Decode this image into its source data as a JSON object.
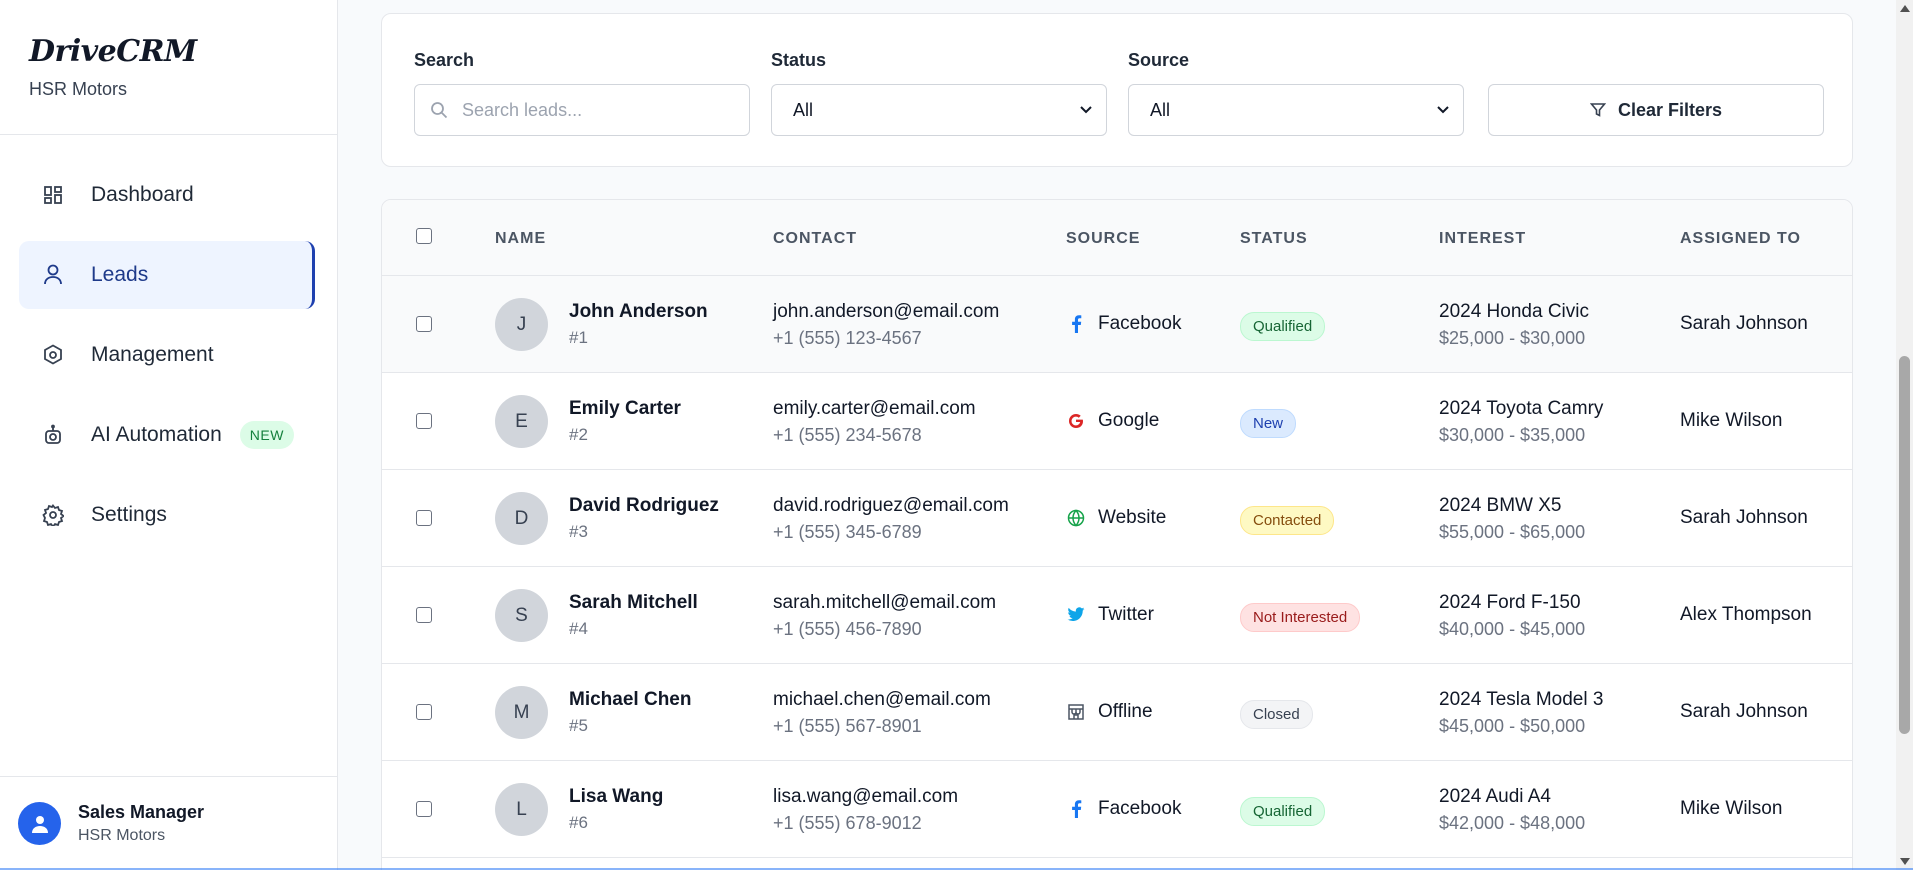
{
  "sidebar": {
    "brand": "DriveCRM",
    "subtitle": "HSR Motors",
    "items": [
      {
        "label": "Dashboard",
        "icon": "dashboard-icon"
      },
      {
        "label": "Leads",
        "icon": "user-icon",
        "active": true
      },
      {
        "label": "Management",
        "icon": "hexagon-icon"
      },
      {
        "label": "AI Automation",
        "icon": "robot-icon",
        "badge": "NEW"
      },
      {
        "label": "Settings",
        "icon": "gear-icon"
      }
    ],
    "user": {
      "name": "Sales Manager",
      "org": "HSR Motors"
    }
  },
  "filters": {
    "search_label": "Search",
    "search_placeholder": "Search leads...",
    "status_label": "Status",
    "status_value": "All",
    "source_label": "Source",
    "source_value": "All",
    "clear_label": "Clear Filters"
  },
  "table": {
    "headers": [
      "NAME",
      "CONTACT",
      "SOURCE",
      "STATUS",
      "INTEREST",
      "ASSIGNED TO"
    ],
    "rows": [
      {
        "initial": "J",
        "name": "John Anderson",
        "id": "#1",
        "email": "john.anderson@email.com",
        "phone": "+1 (555) 123-4567",
        "source": "Facebook",
        "source_icon": "facebook-icon",
        "status": "Qualified",
        "interest": "2024 Honda Civic",
        "range": "$25,000 - $30,000",
        "assigned": "Sarah Johnson"
      },
      {
        "initial": "E",
        "name": "Emily Carter",
        "id": "#2",
        "email": "emily.carter@email.com",
        "phone": "+1 (555) 234-5678",
        "source": "Google",
        "source_icon": "google-icon",
        "status": "New",
        "interest": "2024 Toyota Camry",
        "range": "$30,000 - $35,000",
        "assigned": "Mike Wilson"
      },
      {
        "initial": "D",
        "name": "David Rodriguez",
        "id": "#3",
        "email": "david.rodriguez@email.com",
        "phone": "+1 (555) 345-6789",
        "source": "Website",
        "source_icon": "globe-icon",
        "status": "Contacted",
        "interest": "2024 BMW X5",
        "range": "$55,000 - $65,000",
        "assigned": "Sarah Johnson"
      },
      {
        "initial": "S",
        "name": "Sarah Mitchell",
        "id": "#4",
        "email": "sarah.mitchell@email.com",
        "phone": "+1 (555) 456-7890",
        "source": "Twitter",
        "source_icon": "twitter-icon",
        "status": "Not Interested",
        "interest": "2024 Ford F-150",
        "range": "$40,000 - $45,000",
        "assigned": "Alex Thompson"
      },
      {
        "initial": "M",
        "name": "Michael Chen",
        "id": "#5",
        "email": "michael.chen@email.com",
        "phone": "+1 (555) 567-8901",
        "source": "Offline",
        "source_icon": "store-icon",
        "status": "Closed",
        "interest": "2024 Tesla Model 3",
        "range": "$45,000 - $50,000",
        "assigned": "Sarah Johnson"
      },
      {
        "initial": "L",
        "name": "Lisa Wang",
        "id": "#6",
        "email": "lisa.wang@email.com",
        "phone": "+1 (555) 678-9012",
        "source": "Facebook",
        "source_icon": "facebook-icon",
        "status": "Qualified",
        "interest": "2024 Audi A4",
        "range": "$42,000 - $48,000",
        "assigned": "Mike Wilson"
      }
    ]
  },
  "colors": {
    "accent": "#1e40af",
    "status": {
      "Qualified": {
        "bg": "#dcfce7",
        "fg": "#166534",
        "border": "#bbf7d0"
      },
      "New": {
        "bg": "#dbeafe",
        "fg": "#1e40af",
        "border": "#bfdbfe"
      },
      "Contacted": {
        "bg": "#fef9c3",
        "fg": "#854d0e",
        "border": "#fde68a"
      },
      "Not Interested": {
        "bg": "#fee2e2",
        "fg": "#991b1b",
        "border": "#fecaca"
      },
      "Closed": {
        "bg": "#f3f4f6",
        "fg": "#374151",
        "border": "#e5e7eb"
      }
    }
  }
}
